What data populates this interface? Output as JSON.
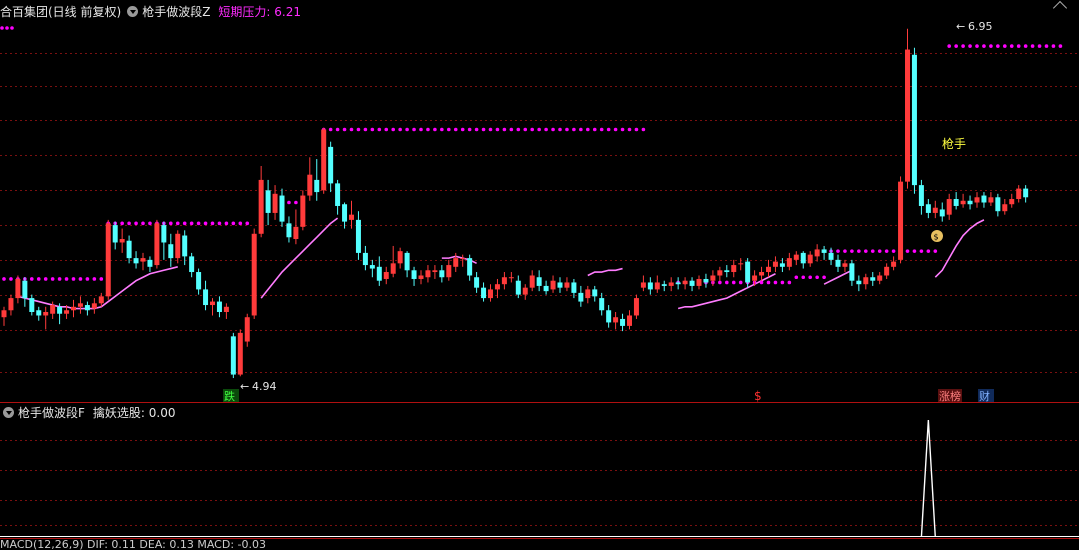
{
  "header": {
    "stock_name": "合百集团(日线 前复权)",
    "indicator_name": "枪手做波段Z",
    "pressure_label": "短期压力: 6.21"
  },
  "sub_header": {
    "indicator_name": "枪手做波段F",
    "value_label": "擒妖选股: 0.00"
  },
  "bottom_header": {
    "text": "MACD(12,26,9) DIF: 0.11 DEA: 0.13 MACD: -0.03"
  },
  "annotations": {
    "low_price": "4.94",
    "high_price": "6.95",
    "gunshot_label": "枪手",
    "fall_tag": "跌",
    "dollar_tag": "$",
    "limitup_tag": "涨榜",
    "finance_tag": "财"
  },
  "colors": {
    "up": "#ff3b3b",
    "down": "#54ffff",
    "ma": "#ff7cff",
    "pressure_dots": "#ff00ff",
    "grid": "#7a1010",
    "signal": "#ffffff"
  },
  "chart_data": [
    {
      "type": "candlestick",
      "title": "合百集团(日线 前复权)",
      "ylim": [
        4.9,
        7.0
      ],
      "grid": true,
      "candles": [
        [
          5.29,
          5.33,
          5.24,
          5.35
        ],
        [
          5.33,
          5.4,
          5.3,
          5.42
        ],
        [
          5.4,
          5.51,
          5.37,
          5.53
        ],
        [
          5.5,
          5.4,
          5.35,
          5.52
        ],
        [
          5.4,
          5.32,
          5.3,
          5.42
        ],
        [
          5.33,
          5.3,
          5.27,
          5.35
        ],
        [
          5.3,
          5.32,
          5.22,
          5.35
        ],
        [
          5.31,
          5.36,
          5.28,
          5.38
        ],
        [
          5.35,
          5.31,
          5.25,
          5.37
        ],
        [
          5.31,
          5.33,
          5.28,
          5.36
        ],
        [
          5.33,
          5.35,
          5.29,
          5.39
        ],
        [
          5.35,
          5.37,
          5.31,
          5.41
        ],
        [
          5.36,
          5.33,
          5.3,
          5.38
        ],
        [
          5.34,
          5.37,
          5.31,
          5.4
        ],
        [
          5.37,
          5.41,
          5.35,
          5.43
        ],
        [
          5.41,
          5.83,
          5.39,
          5.85
        ],
        [
          5.82,
          5.72,
          5.68,
          5.84
        ],
        [
          5.72,
          5.74,
          5.66,
          5.8
        ],
        [
          5.73,
          5.63,
          5.6,
          5.76
        ],
        [
          5.63,
          5.6,
          5.57,
          5.67
        ],
        [
          5.61,
          5.63,
          5.56,
          5.66
        ],
        [
          5.62,
          5.58,
          5.55,
          5.64
        ],
        [
          5.59,
          5.83,
          5.57,
          5.85
        ],
        [
          5.82,
          5.72,
          5.62,
          5.84
        ],
        [
          5.71,
          5.63,
          5.58,
          5.77
        ],
        [
          5.63,
          5.77,
          5.6,
          5.79
        ],
        [
          5.76,
          5.64,
          5.59,
          5.79
        ],
        [
          5.64,
          5.55,
          5.52,
          5.66
        ],
        [
          5.55,
          5.45,
          5.42,
          5.57
        ],
        [
          5.45,
          5.36,
          5.33,
          5.5
        ],
        [
          5.36,
          5.38,
          5.3,
          5.4
        ],
        [
          5.38,
          5.32,
          5.29,
          5.41
        ],
        [
          5.32,
          5.35,
          5.28,
          5.37
        ],
        [
          5.18,
          4.96,
          4.94,
          5.2
        ],
        [
          4.96,
          5.2,
          4.95,
          5.22
        ],
        [
          5.15,
          5.29,
          5.12,
          5.31
        ],
        [
          5.3,
          5.77,
          5.28,
          5.8
        ],
        [
          5.77,
          6.08,
          5.75,
          6.16
        ],
        [
          6.02,
          5.89,
          5.82,
          6.08
        ],
        [
          5.89,
          6.0,
          5.85,
          6.05
        ],
        [
          5.99,
          5.84,
          5.81,
          6.03
        ],
        [
          5.83,
          5.75,
          5.72,
          5.87
        ],
        [
          5.74,
          5.81,
          5.71,
          5.91
        ],
        [
          5.81,
          5.99,
          5.79,
          6.02
        ],
        [
          5.99,
          6.11,
          5.96,
          6.21
        ],
        [
          6.08,
          6.01,
          5.96,
          6.2
        ],
        [
          6.02,
          6.37,
          6.0,
          6.38
        ],
        [
          6.27,
          6.06,
          6.01,
          6.3
        ],
        [
          6.06,
          5.93,
          5.88,
          6.08
        ],
        [
          5.94,
          5.84,
          5.8,
          5.95
        ],
        [
          5.85,
          5.88,
          5.8,
          5.96
        ],
        [
          5.85,
          5.66,
          5.62,
          5.9
        ],
        [
          5.66,
          5.59,
          5.56,
          5.7
        ],
        [
          5.59,
          5.57,
          5.52,
          5.62
        ],
        [
          5.58,
          5.5,
          5.47,
          5.64
        ],
        [
          5.51,
          5.55,
          5.48,
          5.58
        ],
        [
          5.54,
          5.6,
          5.52,
          5.7
        ],
        [
          5.6,
          5.67,
          5.57,
          5.69
        ],
        [
          5.66,
          5.56,
          5.52,
          5.67
        ],
        [
          5.56,
          5.51,
          5.47,
          5.58
        ],
        [
          5.51,
          5.53,
          5.48,
          5.56
        ],
        [
          5.52,
          5.56,
          5.49,
          5.59
        ],
        [
          5.55,
          5.56,
          5.51,
          5.59
        ],
        [
          5.56,
          5.52,
          5.49,
          5.59
        ],
        [
          5.52,
          5.59,
          5.5,
          5.62
        ],
        [
          5.58,
          5.63,
          5.55,
          5.66
        ],
        [
          5.63,
          5.63,
          5.58,
          5.65
        ],
        [
          5.63,
          5.53,
          5.5,
          5.65
        ],
        [
          5.52,
          5.46,
          5.43,
          5.55
        ],
        [
          5.46,
          5.4,
          5.38,
          5.49
        ],
        [
          5.4,
          5.45,
          5.38,
          5.48
        ],
        [
          5.45,
          5.48,
          5.4,
          5.51
        ],
        [
          5.48,
          5.52,
          5.45,
          5.55
        ],
        [
          5.52,
          5.52,
          5.49,
          5.55
        ],
        [
          5.5,
          5.42,
          5.4,
          5.53
        ],
        [
          5.42,
          5.46,
          5.39,
          5.48
        ],
        [
          5.46,
          5.53,
          5.44,
          5.56
        ],
        [
          5.52,
          5.47,
          5.44,
          5.56
        ],
        [
          5.47,
          5.44,
          5.42,
          5.5
        ],
        [
          5.45,
          5.5,
          5.43,
          5.53
        ],
        [
          5.49,
          5.46,
          5.43,
          5.52
        ],
        [
          5.46,
          5.49,
          5.44,
          5.52
        ],
        [
          5.49,
          5.43,
          5.4,
          5.51
        ],
        [
          5.43,
          5.38,
          5.35,
          5.47
        ],
        [
          5.4,
          5.45,
          5.37,
          5.47
        ],
        [
          5.45,
          5.41,
          5.38,
          5.47
        ],
        [
          5.4,
          5.33,
          5.3,
          5.43
        ],
        [
          5.33,
          5.26,
          5.23,
          5.36
        ],
        [
          5.26,
          5.29,
          5.22,
          5.32
        ],
        [
          5.28,
          5.24,
          5.21,
          5.31
        ],
        [
          5.24,
          5.3,
          5.22,
          5.33
        ],
        [
          5.3,
          5.4,
          5.28,
          5.42
        ],
        [
          5.46,
          5.49,
          5.44,
          5.53
        ],
        [
          5.49,
          5.45,
          5.42,
          5.52
        ],
        [
          5.45,
          5.49,
          5.43,
          5.53
        ],
        [
          5.48,
          5.47,
          5.44,
          5.5
        ],
        [
          5.47,
          5.49,
          5.44,
          5.52
        ],
        [
          5.49,
          5.48,
          5.45,
          5.52
        ],
        [
          5.48,
          5.5,
          5.45,
          5.52
        ],
        [
          5.5,
          5.47,
          5.44,
          5.52
        ],
        [
          5.47,
          5.51,
          5.45,
          5.53
        ],
        [
          5.51,
          5.49,
          5.46,
          5.54
        ],
        [
          5.5,
          5.53,
          5.47,
          5.56
        ],
        [
          5.53,
          5.56,
          5.5,
          5.58
        ],
        [
          5.56,
          5.55,
          5.52,
          5.59
        ],
        [
          5.55,
          5.59,
          5.52,
          5.62
        ],
        [
          5.6,
          5.6,
          5.56,
          5.63
        ],
        [
          5.61,
          5.49,
          5.46,
          5.63
        ],
        [
          5.5,
          5.53,
          5.47,
          5.56
        ],
        [
          5.53,
          5.55,
          5.5,
          5.58
        ],
        [
          5.55,
          5.58,
          5.52,
          5.62
        ],
        [
          5.58,
          5.61,
          5.55,
          5.64
        ],
        [
          5.6,
          5.58,
          5.55,
          5.63
        ],
        [
          5.58,
          5.63,
          5.56,
          5.66
        ],
        [
          5.62,
          5.65,
          5.59,
          5.67
        ],
        [
          5.66,
          5.6,
          5.57,
          5.67
        ],
        [
          5.6,
          5.65,
          5.58,
          5.67
        ],
        [
          5.64,
          5.68,
          5.61,
          5.71
        ],
        [
          5.68,
          5.66,
          5.62,
          5.7
        ],
        [
          5.66,
          5.62,
          5.59,
          5.69
        ],
        [
          5.62,
          5.58,
          5.55,
          5.65
        ],
        [
          5.58,
          5.6,
          5.55,
          5.62
        ],
        [
          5.6,
          5.5,
          5.47,
          5.62
        ],
        [
          5.5,
          5.48,
          5.44,
          5.53
        ],
        [
          5.48,
          5.52,
          5.45,
          5.54
        ],
        [
          5.52,
          5.5,
          5.47,
          5.55
        ],
        [
          5.5,
          5.53,
          5.48,
          5.55
        ],
        [
          5.53,
          5.58,
          5.51,
          5.6
        ],
        [
          5.58,
          5.61,
          5.56,
          5.64
        ],
        [
          5.62,
          6.07,
          5.6,
          6.1
        ],
        [
          6.07,
          6.83,
          6.03,
          6.95
        ],
        [
          6.8,
          6.05,
          6.0,
          6.84
        ],
        [
          6.05,
          5.93,
          5.88,
          6.08
        ],
        [
          5.94,
          5.89,
          5.86,
          5.97
        ],
        [
          5.89,
          5.92,
          5.86,
          5.96
        ],
        [
          5.91,
          5.87,
          5.84,
          5.95
        ],
        [
          5.88,
          5.97,
          5.85,
          6.0
        ],
        [
          5.97,
          5.93,
          5.91,
          6.01
        ],
        [
          5.94,
          5.96,
          5.92,
          6.0
        ],
        [
          5.96,
          5.94,
          5.91,
          5.99
        ],
        [
          5.95,
          5.98,
          5.92,
          6.01
        ],
        [
          5.99,
          5.95,
          5.92,
          6.01
        ],
        [
          5.95,
          5.98,
          5.93,
          6.01
        ],
        [
          5.98,
          5.9,
          5.87,
          6.0
        ],
        [
          5.9,
          5.94,
          5.88,
          5.97
        ],
        [
          5.94,
          5.97,
          5.92,
          6.0
        ],
        [
          5.97,
          6.03,
          5.95,
          6.05
        ],
        [
          6.03,
          5.98,
          5.95,
          6.05
        ]
      ],
      "ma_series": [
        {
          "start": 2,
          "values": [
            5.41,
            5.4,
            5.39,
            5.38,
            5.37,
            5.36,
            5.35,
            5.35,
            5.34,
            5.34,
            5.34,
            5.34,
            5.35,
            5.38,
            5.41,
            5.44,
            5.47,
            5.5,
            5.52,
            5.54,
            5.55,
            5.56,
            5.57,
            5.58
          ]
        },
        {
          "start": 37,
          "values": [
            5.4,
            5.45,
            5.5,
            5.55,
            5.59,
            5.63,
            5.67,
            5.71,
            5.75,
            5.79,
            5.83,
            5.86
          ]
        },
        {
          "start": 63,
          "values": [
            5.63,
            5.63,
            5.64,
            5.63,
            5.62,
            5.6
          ]
        },
        {
          "start": 84,
          "values": [
            5.53,
            5.55,
            5.55,
            5.56,
            5.56,
            5.57
          ]
        },
        {
          "start": 97,
          "values": [
            5.34,
            5.35,
            5.35,
            5.36,
            5.37,
            5.38,
            5.39,
            5.4,
            5.42,
            5.44,
            5.46,
            5.48,
            5.5,
            5.52,
            5.54
          ]
        },
        {
          "start": 118,
          "values": [
            5.48,
            5.5,
            5.52,
            5.54,
            5.56
          ]
        },
        {
          "start": 134,
          "values": [
            5.52,
            5.56,
            5.63,
            5.7,
            5.76,
            5.8,
            5.83,
            5.85
          ]
        }
      ],
      "pressure_levels": [
        {
          "start": 0,
          "end": 14,
          "value": 5.51
        },
        {
          "start": 15,
          "end": 35,
          "value": 5.83
        },
        {
          "start": 37,
          "end": 43,
          "value": 5.95
        },
        {
          "start": 46,
          "end": 92,
          "value": 6.37
        },
        {
          "start": 97,
          "end": 113,
          "value": 5.49
        },
        {
          "start": 114,
          "end": 118,
          "value": 5.52
        },
        {
          "start": 119,
          "end": 134,
          "value": 5.67
        },
        {
          "start": 136,
          "end": 152,
          "value": 6.85
        }
      ]
    },
    {
      "type": "line",
      "title": "枪手做波段F",
      "ylim": [
        0,
        1
      ],
      "values_by_index": {
        "132": 0.0,
        "133": 1.0,
        "134": 0.0
      }
    }
  ]
}
